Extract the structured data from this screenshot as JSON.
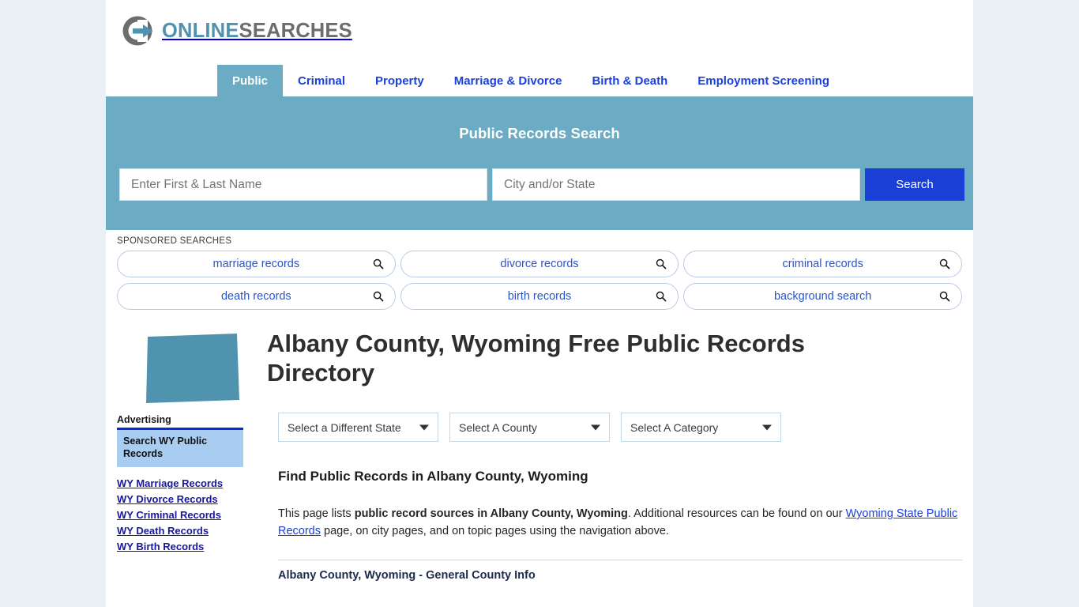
{
  "brand": {
    "logo_icon": "circular-arrow-logo-icon",
    "name_part1": "ONLINE",
    "name_part2": "SEARCHES",
    "accent_color": "#4f93ae",
    "gray_color": "#6d6d6d"
  },
  "nav": {
    "tabs": [
      {
        "label": "Public",
        "active": true
      },
      {
        "label": "Criminal",
        "active": false
      },
      {
        "label": "Property",
        "active": false
      },
      {
        "label": "Marriage & Divorce",
        "active": false
      },
      {
        "label": "Birth & Death",
        "active": false
      },
      {
        "label": "Employment Screening",
        "active": false
      }
    ]
  },
  "search_panel": {
    "title": "Public Records Search",
    "name_placeholder": "Enter First & Last Name",
    "name_value": "",
    "location_placeholder": "City and/or State",
    "location_value": "",
    "button_label": "Search",
    "panel_color": "#6babc4",
    "button_color": "#1a3fd6"
  },
  "sponsored": {
    "label": "SPONSORED SEARCHES",
    "items": [
      {
        "label": "marriage records"
      },
      {
        "label": "divorce records"
      },
      {
        "label": "criminal records"
      },
      {
        "label": "death records"
      },
      {
        "label": "birth records"
      },
      {
        "label": "background search"
      }
    ]
  },
  "page": {
    "state_shape_name": "wyoming-state-shape",
    "state_shape_color": "#4f93ae",
    "title": "Albany County, Wyoming Free Public Records Directory"
  },
  "selectors": [
    {
      "label": "Select a Different State"
    },
    {
      "label": "Select A County"
    },
    {
      "label": "Select A Category"
    }
  ],
  "main": {
    "section_heading": "Find Public Records in Albany County, Wyoming",
    "paragraph": {
      "part1": "This page lists ",
      "bold1": "public record sources in Albany County, Wyoming",
      "part2": ". Additional resources can be found on our ",
      "link1": "Wyoming State Public Records",
      "part3": " page, on city pages, and on topic pages using the navigation above."
    },
    "table_heading": "Albany County, Wyoming - General County Info"
  },
  "sidebar": {
    "advertising_label": "Advertising",
    "ad_box_text": "Search WY Public Records",
    "links": [
      {
        "label": "WY Marriage Records"
      },
      {
        "label": "WY Divorce Records"
      },
      {
        "label": "WY Criminal Records"
      },
      {
        "label": "WY Death Records"
      },
      {
        "label": "WY Birth Records"
      }
    ]
  }
}
